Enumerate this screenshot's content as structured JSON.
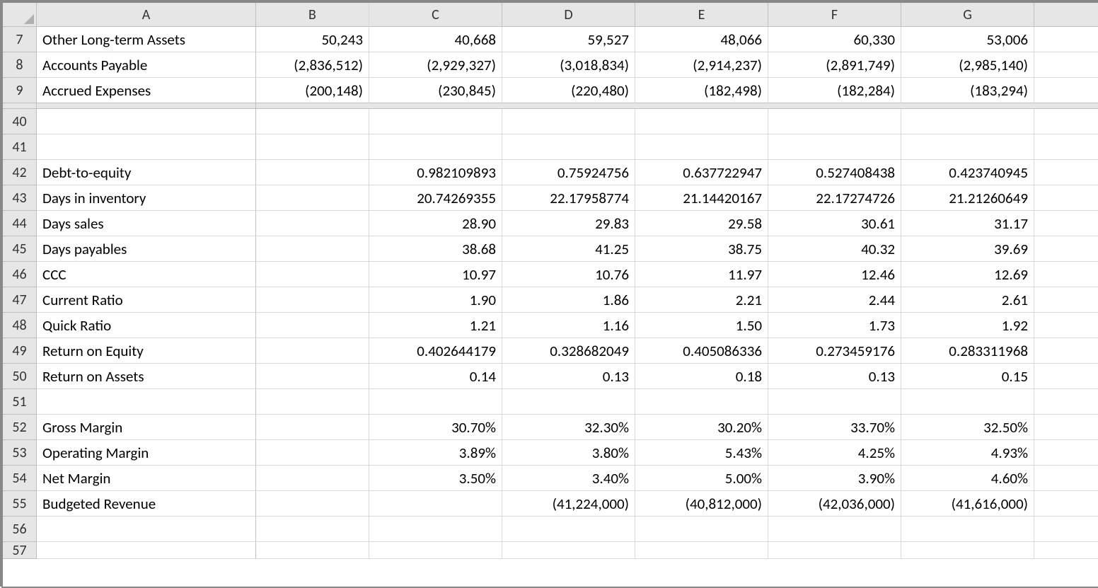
{
  "columns": [
    "A",
    "B",
    "C",
    "D",
    "E",
    "F",
    "G"
  ],
  "rowNumbers": [
    "7",
    "8",
    "9",
    "40",
    "41",
    "42",
    "43",
    "44",
    "45",
    "46",
    "47",
    "48",
    "49",
    "50",
    "51",
    "52",
    "53",
    "54",
    "55",
    "56",
    "57"
  ],
  "rows": {
    "7": {
      "A": "Other Long-term Assets",
      "B": "50,243",
      "C": "40,668",
      "D": "59,527",
      "E": "48,066",
      "F": "60,330",
      "G": "53,006"
    },
    "8": {
      "A": "Accounts Payable",
      "B": "(2,836,512)",
      "C": "(2,929,327)",
      "D": "(3,018,834)",
      "E": "(2,914,237)",
      "F": "(2,891,749)",
      "G": "(2,985,140)"
    },
    "9": {
      "A": "Accrued Expenses",
      "B": "(200,148)",
      "C": "(230,845)",
      "D": "(220,480)",
      "E": "(182,498)",
      "F": "(182,284)",
      "G": "(183,294)"
    },
    "40": {
      "A": "",
      "B": "",
      "C": "",
      "D": "",
      "E": "",
      "F": "",
      "G": ""
    },
    "41": {
      "A": "",
      "B": "",
      "C": "",
      "D": "",
      "E": "",
      "F": "",
      "G": ""
    },
    "42": {
      "A": "Debt-to-equity",
      "B": "",
      "C": "0.982109893",
      "D": "0.75924756",
      "E": "0.637722947",
      "F": "0.527408438",
      "G": "0.423740945"
    },
    "43": {
      "A": "Days in inventory",
      "B": "",
      "C": "20.74269355",
      "D": "22.17958774",
      "E": "21.14420167",
      "F": "22.17274726",
      "G": "21.21260649"
    },
    "44": {
      "A": "Days sales",
      "B": "",
      "C": "28.90",
      "D": "29.83",
      "E": "29.58",
      "F": "30.61",
      "G": "31.17"
    },
    "45": {
      "A": "Days payables",
      "B": "",
      "C": "38.68",
      "D": "41.25",
      "E": "38.75",
      "F": "40.32",
      "G": "39.69"
    },
    "46": {
      "A": "CCC",
      "B": "",
      "C": "10.97",
      "D": "10.76",
      "E": "11.97",
      "F": "12.46",
      "G": "12.69"
    },
    "47": {
      "A": "Current Ratio",
      "B": "",
      "C": "1.90",
      "D": "1.86",
      "E": "2.21",
      "F": "2.44",
      "G": "2.61"
    },
    "48": {
      "A": "Quick Ratio",
      "B": "",
      "C": "1.21",
      "D": "1.16",
      "E": "1.50",
      "F": "1.73",
      "G": "1.92"
    },
    "49": {
      "A": "Return on Equity",
      "B": "",
      "C": "0.402644179",
      "D": "0.328682049",
      "E": "0.405086336",
      "F": "0.273459176",
      "G": "0.283311968"
    },
    "50": {
      "A": "Return on Assets",
      "B": "",
      "C": "0.14",
      "D": "0.13",
      "E": "0.18",
      "F": "0.13",
      "G": "0.15"
    },
    "51": {
      "A": "",
      "B": "",
      "C": "",
      "D": "",
      "E": "",
      "F": "",
      "G": ""
    },
    "52": {
      "A": "Gross Margin",
      "B": "",
      "C": "30.70%",
      "D": "32.30%",
      "E": "30.20%",
      "F": "33.70%",
      "G": "32.50%"
    },
    "53": {
      "A": "Operating Margin",
      "B": "",
      "C": "3.89%",
      "D": "3.80%",
      "E": "5.43%",
      "F": "4.25%",
      "G": "4.93%"
    },
    "54": {
      "A": "Net Margin",
      "B": "",
      "C": "3.50%",
      "D": "3.40%",
      "E": "5.00%",
      "F": "3.90%",
      "G": "4.60%"
    },
    "55": {
      "A": "Budgeted Revenue",
      "B": "",
      "C": "",
      "D": "(41,224,000)",
      "E": "(40,812,000)",
      "F": "(42,036,000)",
      "G": "(41,616,000)"
    },
    "56": {
      "A": "",
      "B": "",
      "C": "",
      "D": "",
      "E": "",
      "F": "",
      "G": ""
    },
    "57": {
      "A": "",
      "B": "",
      "C": "",
      "D": "",
      "E": "",
      "F": "",
      "G": ""
    }
  }
}
